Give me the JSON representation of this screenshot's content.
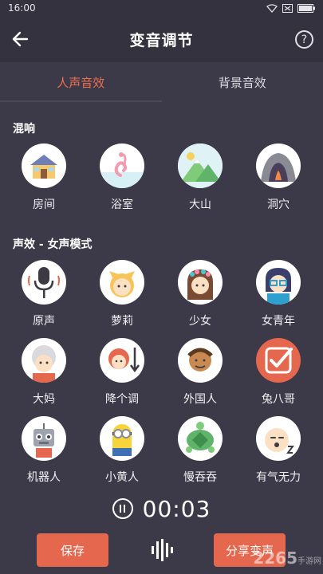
{
  "status": {
    "time": "16:00"
  },
  "header": {
    "title": "变音调节",
    "help": "?"
  },
  "tabs": [
    {
      "label": "人声音效",
      "active": true
    },
    {
      "label": "背景音效",
      "active": false
    }
  ],
  "sections": {
    "reverb": {
      "title": "混响",
      "items": [
        {
          "label": "房间",
          "icon": "house-icon"
        },
        {
          "label": "浴室",
          "icon": "flamingo-icon"
        },
        {
          "label": "大山",
          "icon": "mountain-icon"
        },
        {
          "label": "洞穴",
          "icon": "cave-icon"
        }
      ]
    },
    "voice": {
      "title": "声效 - 女声模式",
      "items": [
        {
          "label": "原声",
          "icon": "microphone-icon"
        },
        {
          "label": "萝莉",
          "icon": "girl-cat-ears-icon"
        },
        {
          "label": "少女",
          "icon": "girl-flower-crown-icon"
        },
        {
          "label": "女青年",
          "icon": "woman-glasses-icon"
        },
        {
          "label": "大妈",
          "icon": "old-woman-icon"
        },
        {
          "label": "降个调",
          "icon": "pitch-down-icon"
        },
        {
          "label": "外国人",
          "icon": "foreigner-icon"
        },
        {
          "label": "兔八哥",
          "icon": "checkmark-icon"
        },
        {
          "label": "机器人",
          "icon": "robot-icon"
        },
        {
          "label": "小黄人",
          "icon": "minion-icon"
        },
        {
          "label": "慢吞吞",
          "icon": "turtle-icon"
        },
        {
          "label": "有气无力",
          "icon": "sleepy-face-icon"
        }
      ]
    }
  },
  "player": {
    "time": "00:03"
  },
  "buttons": {
    "save": "保存",
    "share": "分享变声"
  },
  "watermark": {
    "brand": "2265",
    "site": "手游网"
  },
  "colors": {
    "accent": "#ec6e50",
    "background": "#3c3a48",
    "button": "#e5674e"
  }
}
